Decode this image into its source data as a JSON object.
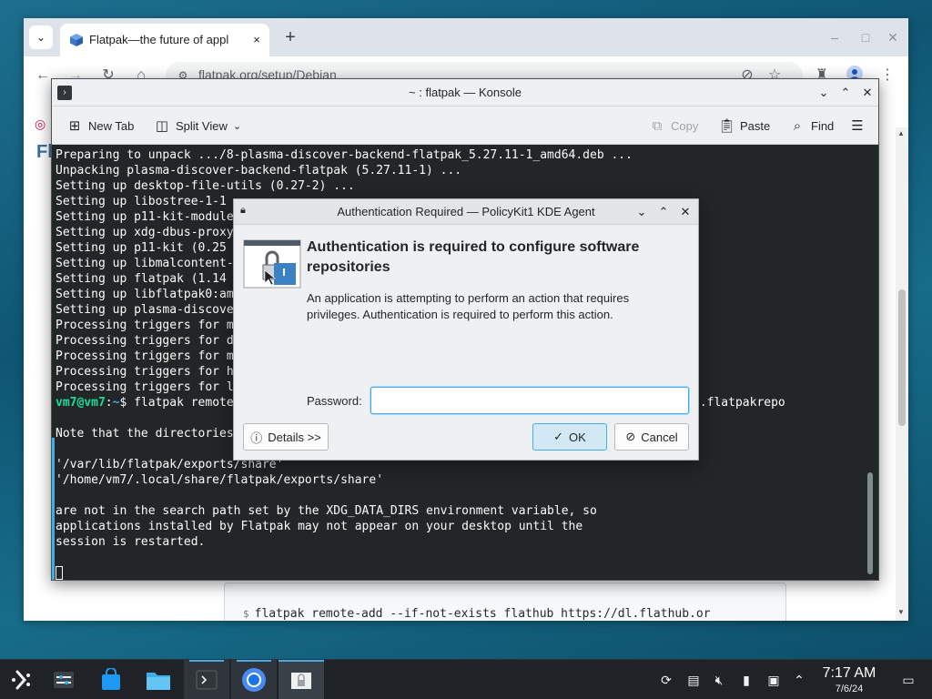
{
  "browser": {
    "tab_list_icon": "chevron-down-icon",
    "tab": {
      "title": "Flatpak—the future of appl",
      "favicon": "flatpak-cube-icon",
      "close": "×"
    },
    "new_tab": "+",
    "window_controls": {
      "minimize": "–",
      "maximize": "□",
      "close": "✕"
    },
    "url": "flatpak.org/setup/Debian",
    "toolbar_icons": [
      "back-icon",
      "forward-icon",
      "reload-icon",
      "home-icon",
      "site-info-icon",
      "eye-off-icon",
      "bookmark-star-icon",
      "extensions-icon",
      "profile-icon",
      "kebab-menu-icon"
    ],
    "page": {
      "edge_letter": "Fl",
      "code_snippet": "flatpak remote-add --if-not-exists flathub https://dl.flathub.or",
      "code_prompt": "$"
    }
  },
  "konsole": {
    "title": "~ : flatpak — Konsole",
    "toolbar": {
      "new_tab": "New Tab",
      "split_view": "Split View",
      "copy": "Copy",
      "paste": "Paste",
      "find": "Find"
    },
    "terminal_lines": [
      "Preparing to unpack .../8-plasma-discover-backend-flatpak_5.27.11-1_amd64.deb ...",
      "Unpacking plasma-discover-backend-flatpak (5.27.11-1) ...",
      "Setting up desktop-file-utils (0.27-2) ...",
      "Setting up libostree-1-1",
      "Setting up p11-kit-module",
      "Setting up xdg-dbus-proxy",
      "Setting up p11-kit (0.25",
      "Setting up libmalcontent-",
      "Setting up flatpak (1.14",
      "Setting up libflatpak0:am",
      "Setting up plasma-discove",
      "Processing triggers for m",
      "Processing triggers for d",
      "Processing triggers for m",
      "Processing triggers for h",
      "Processing triggers for l"
    ],
    "prompt_user": "vm7@vm7",
    "prompt_path": "~",
    "prompt_symbol": "$",
    "command_start": " flatpak remote",
    "command_end": "b.flatpakrepo",
    "note_line": "Note that the directories",
    "dir1": "'/var/lib/flatpak/exports/share'",
    "dir2": "'/home/vm7/.local/share/flatpak/exports/share'",
    "tail_lines": [
      "are not in the search path set by the XDG_DATA_DIRS environment variable, so",
      "applications installed by Flatpak may not appear on your desktop until the",
      "session is restarted."
    ]
  },
  "auth_dialog": {
    "title": "Authentication Required — PolicyKit1 KDE Agent",
    "heading": "Authentication is required to configure software repositories",
    "description": "An application is attempting to perform an action that requires privileges. Authentication is required to perform this action.",
    "password_label": "Password:",
    "password_value": "",
    "details_button": "Details >>",
    "ok_button": "OK",
    "cancel_button": "Cancel"
  },
  "taskbar": {
    "items": [
      "application-launcher-icon",
      "system-settings-icon",
      "discover-store-icon",
      "file-manager-icon",
      "konsole-icon",
      "chromium-icon",
      "polkit-lock-icon"
    ],
    "tray": [
      "updates-icon",
      "clipboard-icon",
      "volume-muted-icon",
      "battery-icon",
      "network-icon",
      "tray-expand-icon",
      "show-desktop-icon"
    ],
    "clock_time": "7:17 AM",
    "clock_date": "7/6/24"
  },
  "colors": {
    "accent": "#3daee9",
    "terminal_bg": "#232627",
    "prompt_green": "#1cdc9a",
    "taskbar_bg": "#1f2328"
  }
}
